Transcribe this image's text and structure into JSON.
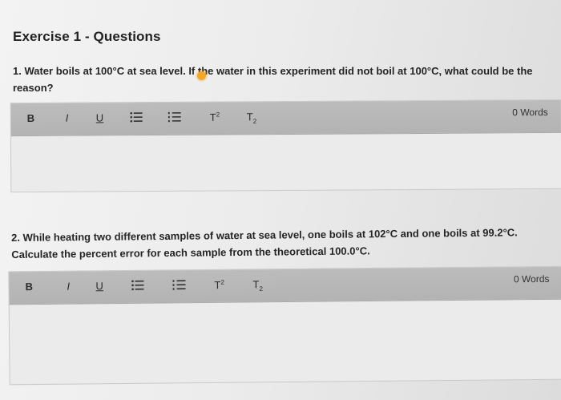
{
  "page": {
    "title": "Exercise 1 - Questions"
  },
  "questions": [
    {
      "text": "1. Water boils at 100°C at sea level. If the water in this experiment did not boil at 100°C, what could be the reason?",
      "word_count": "0 Words"
    },
    {
      "text": "2. While heating two different samples of water at sea level, one boils at 102°C and one boils at 99.2°C. Calculate the percent error for each sample from the theoretical 100.0°C.",
      "word_count": "0 Words"
    }
  ],
  "toolbar": {
    "bold": "B",
    "italic": "I",
    "underline": "U",
    "superscript": "T",
    "subscript": "T",
    "sup_mark": "2",
    "sub_mark": "2",
    "icons": [
      "bold",
      "italic",
      "underline",
      "bullet-list-icon",
      "numbered-list-icon",
      "superscript",
      "subscript"
    ]
  },
  "colors": {
    "toolbar": "#b7b7b7",
    "editor_bg": "#ebebeb",
    "cursor": "#f5a623"
  }
}
